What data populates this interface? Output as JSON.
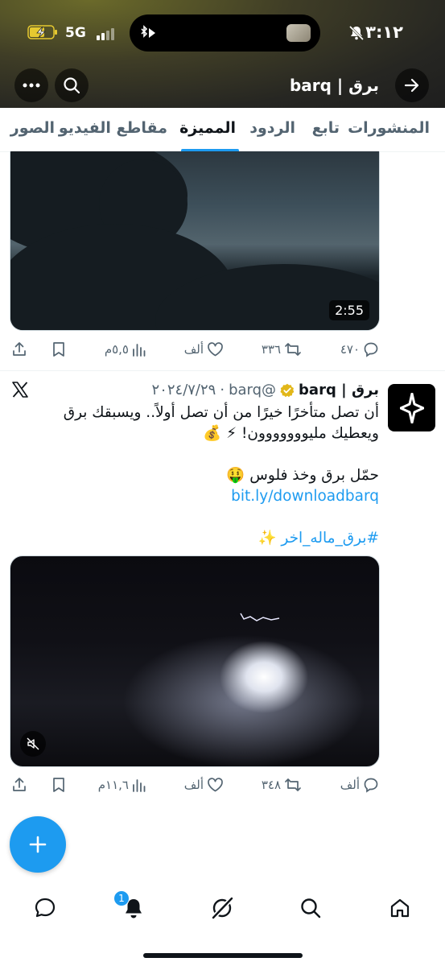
{
  "status_bar": {
    "time": "٣:١٢",
    "network": "5G"
  },
  "header": {
    "title": "برق | barq"
  },
  "tabs": [
    {
      "label": "المنشورات",
      "active": false
    },
    {
      "label": "تابع",
      "active": false
    },
    {
      "label": "الردود",
      "active": false
    },
    {
      "label": "المميزة",
      "active": true
    },
    {
      "label": "مقاطع الفيديو",
      "active": false
    },
    {
      "label": "الصور",
      "active": false
    }
  ],
  "post1": {
    "video_duration": "2:55",
    "replies": "٤٧٠",
    "reposts": "٣٣٦",
    "likes": "ألف",
    "views": "٥,٥م"
  },
  "post2": {
    "display_name": "برق | barq",
    "handle": "@barq",
    "date": "٢٠٢٤/٧/٢٩",
    "text_line1": "أن تصل متأخرًا خيرًا من أن تصل أولاً.. ويسبقك برق",
    "text_line2": "ويعطيك مليووووووون! ⚡ 💰",
    "text_line3": "حمّل برق وخذ فلوس 🤑",
    "link": "bit.ly/downloadbarq",
    "hashtag": "#برق_ماله_اخر ✨",
    "replies": "ألف",
    "reposts": "٣٤٨",
    "likes": "ألف",
    "views": "١١,٦م"
  },
  "bottom_nav": {
    "notifications_badge": "1"
  },
  "colors": {
    "accent": "#1d9bf0",
    "text": "#0f1419",
    "muted": "#536471",
    "verified": "#e2b719"
  }
}
